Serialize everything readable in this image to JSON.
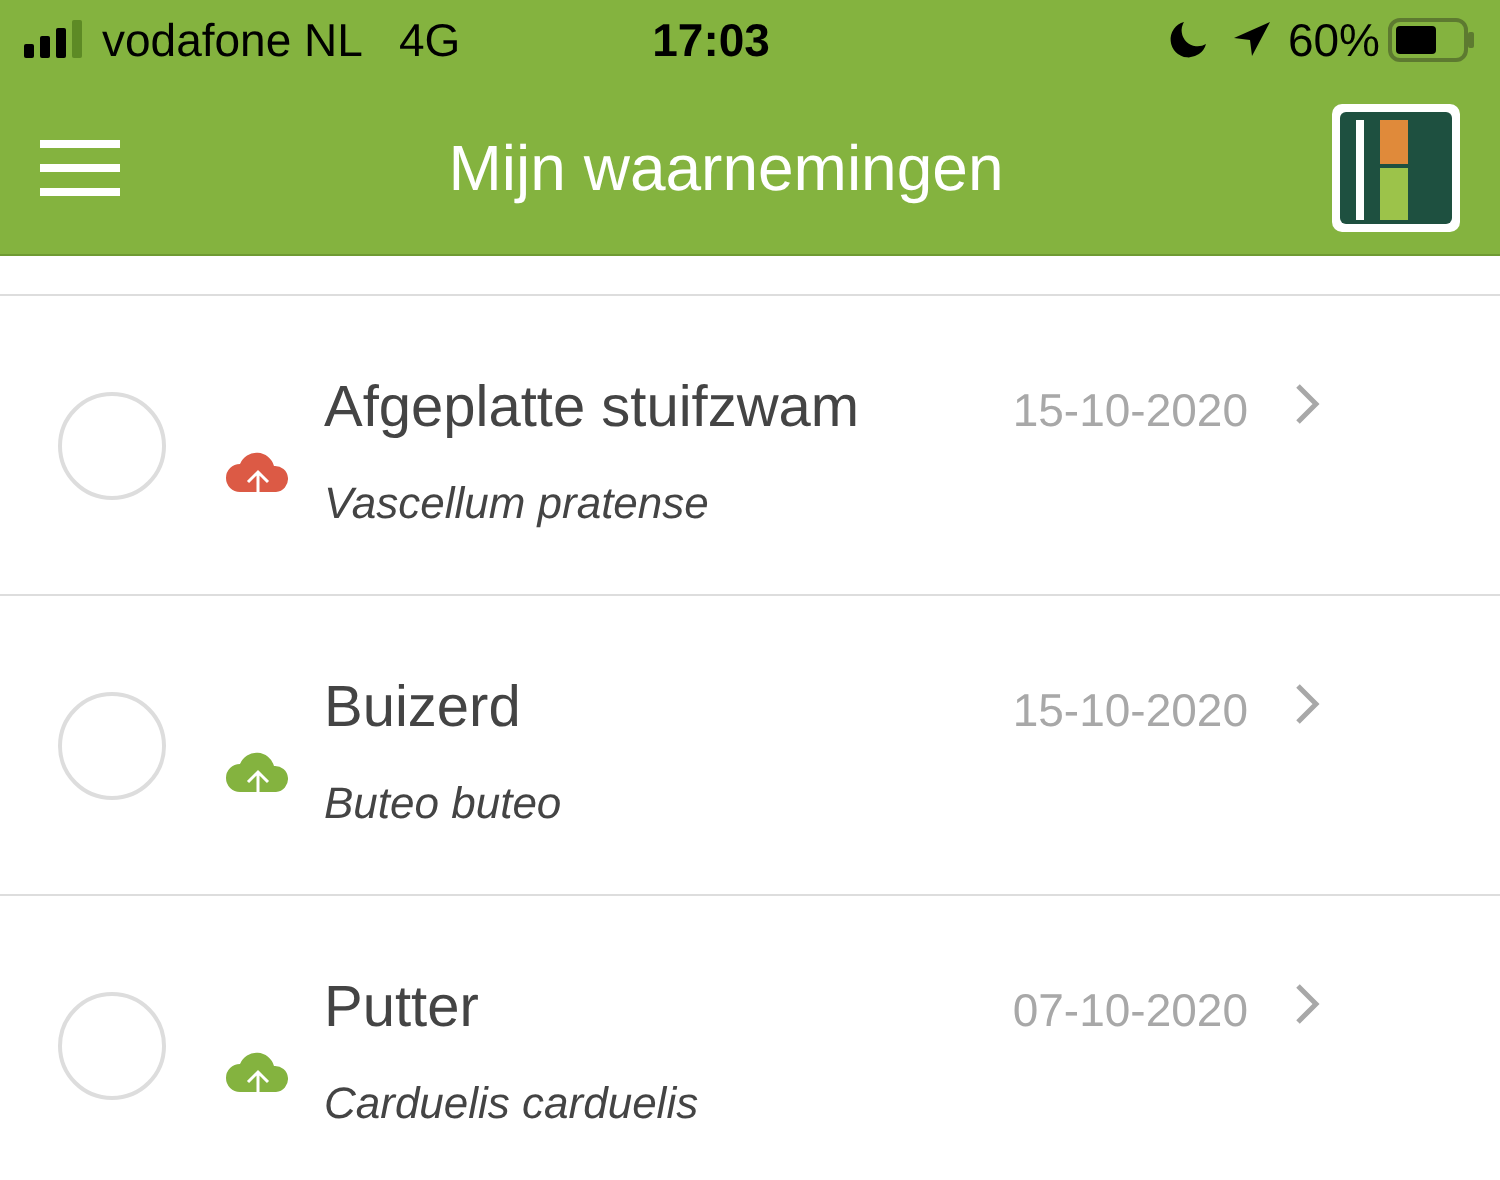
{
  "status_bar": {
    "carrier": "vodafone NL",
    "network": "4G",
    "time": "17:03",
    "battery": "60%"
  },
  "header": {
    "title": "Mijn waarnemingen"
  },
  "observations": [
    {
      "name": "Afgeplatte stuifzwam",
      "latin": "Vascellum pratense",
      "date": "15-10-2020",
      "selected": false,
      "color": "#dc5a45"
    },
    {
      "name": "Buizerd",
      "latin": "Buteo buteo",
      "date": "15-10-2020",
      "selected": false,
      "color": "#84b33f"
    },
    {
      "name": "Putter",
      "latin": "Carduelis carduelis",
      "date": "07-10-2020",
      "selected": false,
      "color": "#84b33f"
    }
  ]
}
